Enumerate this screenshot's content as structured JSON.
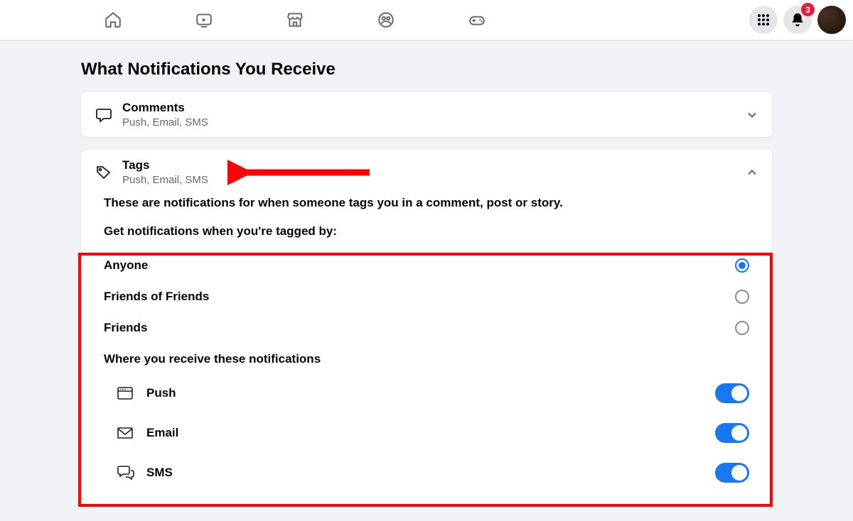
{
  "header": {
    "badge_count": "3"
  },
  "page": {
    "title": "What Notifications You Receive"
  },
  "comments": {
    "title": "Comments",
    "sub": "Push, Email, SMS"
  },
  "tags": {
    "title": "Tags",
    "sub": "Push, Email, SMS",
    "desc": "These are notifications for when someone tags you in a comment, post or story.",
    "subhead": "Get notifications when you're tagged by:",
    "options": {
      "anyone": "Anyone",
      "fof": "Friends of Friends",
      "friends": "Friends"
    },
    "where": "Where you receive these notifications",
    "channels": {
      "push": "Push",
      "email": "Email",
      "sms": "SMS"
    }
  }
}
